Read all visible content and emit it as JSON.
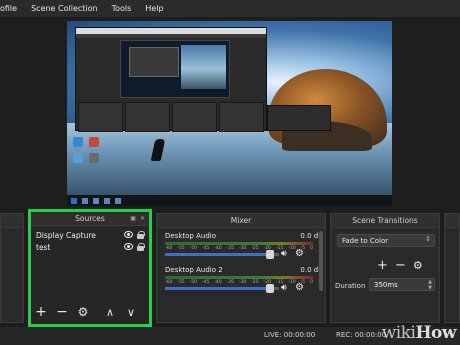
{
  "menu": {
    "items": [
      "ofile",
      "Scene Collection",
      "Tools",
      "Help"
    ]
  },
  "sources": {
    "title": "Sources",
    "items": [
      {
        "label": "Display Capture"
      },
      {
        "label": "test"
      }
    ],
    "toolbar": {
      "add": "+",
      "remove": "−",
      "settings": "⚙",
      "up": "∧",
      "down": "∨"
    },
    "highlight_color": "#22d04a"
  },
  "mixer": {
    "title": "Mixer",
    "tracks": [
      {
        "label": "Desktop Audio",
        "level": "0.0 dB",
        "volume": 0.92
      },
      {
        "label": "Desktop Audio 2",
        "level": "0.0 dB",
        "volume": 0.92
      }
    ],
    "scale": [
      "-60",
      "-55",
      "-50",
      "-45",
      "-40",
      "-35",
      "-30",
      "-25",
      "-20",
      "-15",
      "-10",
      "-5",
      "0"
    ]
  },
  "transitions": {
    "title": "Scene Transitions",
    "selected": "Fade to Color",
    "duration_label": "Duration",
    "duration_value": "350ms"
  },
  "status": {
    "live": "LIVE: 00:00:00",
    "rec": "REC: 00:00:00"
  },
  "watermark": {
    "part1": "wiki",
    "part2": "How"
  }
}
